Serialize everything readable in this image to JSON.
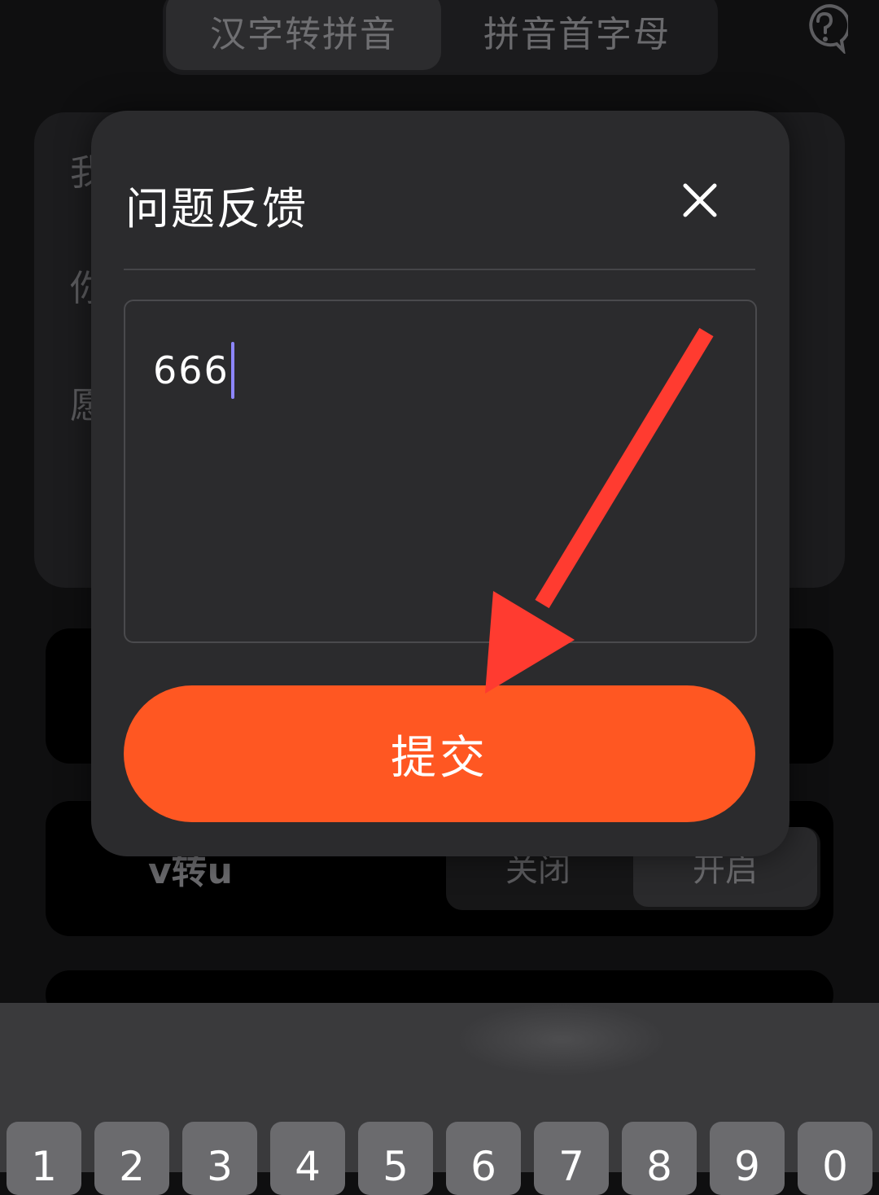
{
  "header": {
    "tabs": [
      {
        "label": "汉字转拼音",
        "active": true
      },
      {
        "label": "拼音首字母",
        "active": false
      }
    ],
    "help_icon": "question-circle-icon"
  },
  "background_card": {
    "peek_chars": [
      "我",
      "你",
      "愿"
    ]
  },
  "settings": {
    "v2u_label": "v转u",
    "toggle_off_label": "关闭",
    "toggle_on_label": "开启",
    "selected": "开启"
  },
  "modal": {
    "title": "问题反馈",
    "close_icon": "close-icon",
    "feedback_value": "666",
    "submit_label": "提交"
  },
  "annotation": {
    "type": "arrow",
    "color": "#ff3b30",
    "target": "submit-button"
  },
  "keyboard": {
    "keys": [
      "1",
      "2",
      "3",
      "4",
      "5",
      "6",
      "7",
      "8",
      "9",
      "0"
    ]
  },
  "colors": {
    "accent": "#ff5722",
    "caret": "#8d86ff",
    "modal_bg": "#2b2b2d"
  }
}
